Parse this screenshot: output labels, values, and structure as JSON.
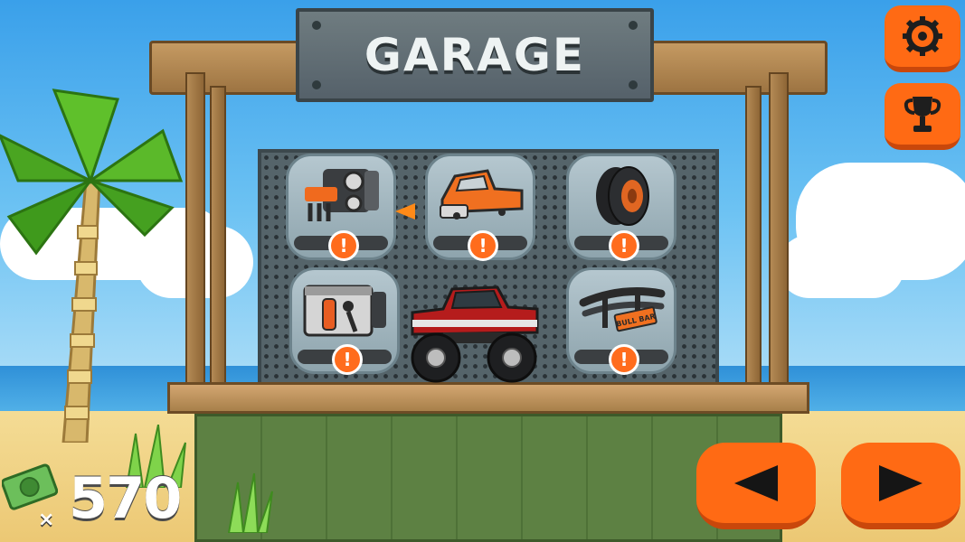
{
  "garage": {
    "title": "GARAGE"
  },
  "parts": [
    {
      "name": "engine",
      "icon": "engine-icon",
      "status": "!"
    },
    {
      "name": "body",
      "icon": "truck-body-icon",
      "status": "!"
    },
    {
      "name": "tires",
      "icon": "tire-icon",
      "status": "!"
    },
    {
      "name": "suspension",
      "icon": "suspension-icon",
      "status": "!"
    },
    {
      "name": "bull bar",
      "icon": "bull-bar-icon",
      "status": "!"
    }
  ],
  "bullbar_plate": "BULL BAR",
  "vehicle": {
    "icon": "monster-truck-icon"
  },
  "buttons": {
    "settings": "gear-icon",
    "trophies": "trophy-icon",
    "previous": "arrow-left-icon",
    "next": "arrow-right-icon"
  },
  "currency": {
    "icon": "cash-icon",
    "multiplier": "×",
    "amount": "570"
  },
  "colors": {
    "accent": "#ff6a14",
    "alert": "#ff6c1d",
    "sign": "#5f6c72",
    "counter": "#5d8143"
  }
}
